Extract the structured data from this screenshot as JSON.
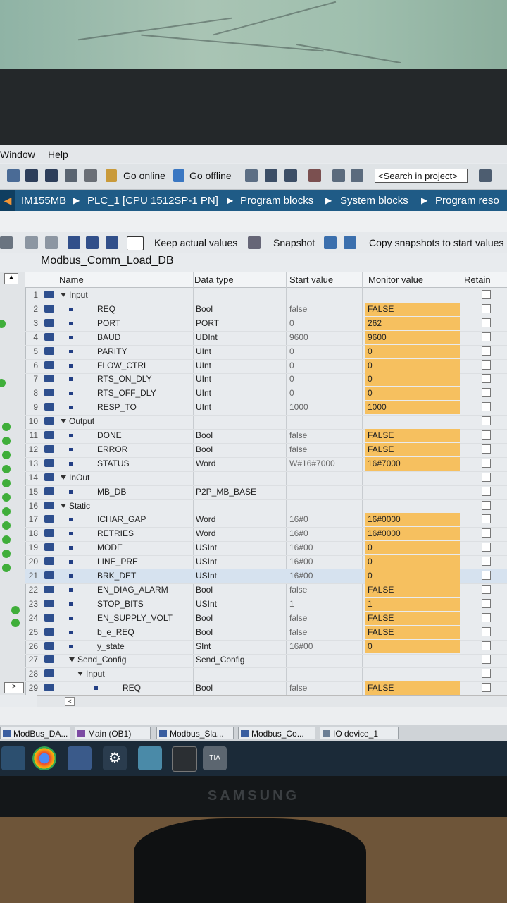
{
  "menu": {
    "window": "Window",
    "help": "Help"
  },
  "toolbar": {
    "go_online": "Go online",
    "go_offline": "Go offline",
    "search_placeholder": "<Search in project>"
  },
  "breadcrumb": [
    "IM155MB",
    "PLC_1 [CPU 1512SP-1 PN]",
    "Program blocks",
    "System blocks",
    "Program reso"
  ],
  "db_toolbar": {
    "keep_actual_values": "Keep actual values",
    "snapshot": "Snapshot",
    "copy_snapshots": "Copy snapshots to start values"
  },
  "db_name": "Modbus_Comm_Load_DB",
  "columns": {
    "name": "Name",
    "data_type": "Data type",
    "start_value": "Start value",
    "monitor_value": "Monitor value",
    "retain": "Retain"
  },
  "rows": [
    {
      "num": "1",
      "name": "Input",
      "type": "",
      "start": "",
      "monitor": "",
      "section": true
    },
    {
      "num": "2",
      "name": "REQ",
      "type": "Bool",
      "start": "false",
      "monitor": "FALSE"
    },
    {
      "num": "3",
      "name": "PORT",
      "type": "PORT",
      "start": "0",
      "monitor": "262"
    },
    {
      "num": "4",
      "name": "BAUD",
      "type": "UDInt",
      "start": "9600",
      "monitor": "9600"
    },
    {
      "num": "5",
      "name": "PARITY",
      "type": "UInt",
      "start": "0",
      "monitor": "0"
    },
    {
      "num": "6",
      "name": "FLOW_CTRL",
      "type": "UInt",
      "start": "0",
      "monitor": "0"
    },
    {
      "num": "7",
      "name": "RTS_ON_DLY",
      "type": "UInt",
      "start": "0",
      "monitor": "0"
    },
    {
      "num": "8",
      "name": "RTS_OFF_DLY",
      "type": "UInt",
      "start": "0",
      "monitor": "0"
    },
    {
      "num": "9",
      "name": "RESP_TO",
      "type": "UInt",
      "start": "1000",
      "monitor": "1000"
    },
    {
      "num": "10",
      "name": "Output",
      "type": "",
      "start": "",
      "monitor": "",
      "section": true
    },
    {
      "num": "11",
      "name": "DONE",
      "type": "Bool",
      "start": "false",
      "monitor": "FALSE"
    },
    {
      "num": "12",
      "name": "ERROR",
      "type": "Bool",
      "start": "false",
      "monitor": "FALSE"
    },
    {
      "num": "13",
      "name": "STATUS",
      "type": "Word",
      "start": "W#16#7000",
      "monitor": "16#7000"
    },
    {
      "num": "14",
      "name": "InOut",
      "type": "",
      "start": "",
      "monitor": "",
      "section": true
    },
    {
      "num": "15",
      "name": "MB_DB",
      "type": "P2P_MB_BASE",
      "start": "",
      "monitor": ""
    },
    {
      "num": "16",
      "name": "Static",
      "type": "",
      "start": "",
      "monitor": "",
      "section": true
    },
    {
      "num": "17",
      "name": "ICHAR_GAP",
      "type": "Word",
      "start": "16#0",
      "monitor": "16#0000"
    },
    {
      "num": "18",
      "name": "RETRIES",
      "type": "Word",
      "start": "16#0",
      "monitor": "16#0000"
    },
    {
      "num": "19",
      "name": "MODE",
      "type": "USInt",
      "start": "16#00",
      "monitor": "0"
    },
    {
      "num": "20",
      "name": "LINE_PRE",
      "type": "USInt",
      "start": "16#00",
      "monitor": "0"
    },
    {
      "num": "21",
      "name": "BRK_DET",
      "type": "USInt",
      "start": "16#00",
      "monitor": "0",
      "selected": true
    },
    {
      "num": "22",
      "name": "EN_DIAG_ALARM",
      "type": "Bool",
      "start": "false",
      "monitor": "FALSE"
    },
    {
      "num": "23",
      "name": "STOP_BITS",
      "type": "USInt",
      "start": "1",
      "monitor": "1"
    },
    {
      "num": "24",
      "name": "EN_SUPPLY_VOLT",
      "type": "Bool",
      "start": "false",
      "monitor": "FALSE"
    },
    {
      "num": "25",
      "name": "b_e_REQ",
      "type": "Bool",
      "start": "false",
      "monitor": "FALSE"
    },
    {
      "num": "26",
      "name": "y_state",
      "type": "SInt",
      "start": "16#00",
      "monitor": "0"
    },
    {
      "num": "27",
      "name": "Send_Config",
      "type": "Send_Config",
      "start": "",
      "monitor": "",
      "section": true
    },
    {
      "num": "28",
      "name": "Input",
      "type": "",
      "start": "",
      "monitor": "",
      "section": true
    },
    {
      "num": "29",
      "name": "REQ",
      "type": "Bool",
      "start": "false",
      "monitor": "FALSE"
    }
  ],
  "editor_tabs": [
    "ModBus_DA...",
    "Main (OB1)",
    "Modbus_Sla...",
    "Modbus_Co...",
    "IO device_1"
  ],
  "taskbar_tia": "TIA V15.1",
  "monitor_brand": "SAMSUNG",
  "colors": {
    "crumb_bg": "#1f5b86",
    "crumb_accent": "#f29535",
    "monitor_cell": "#f6c05f",
    "status_ok": "#3fae3a"
  }
}
